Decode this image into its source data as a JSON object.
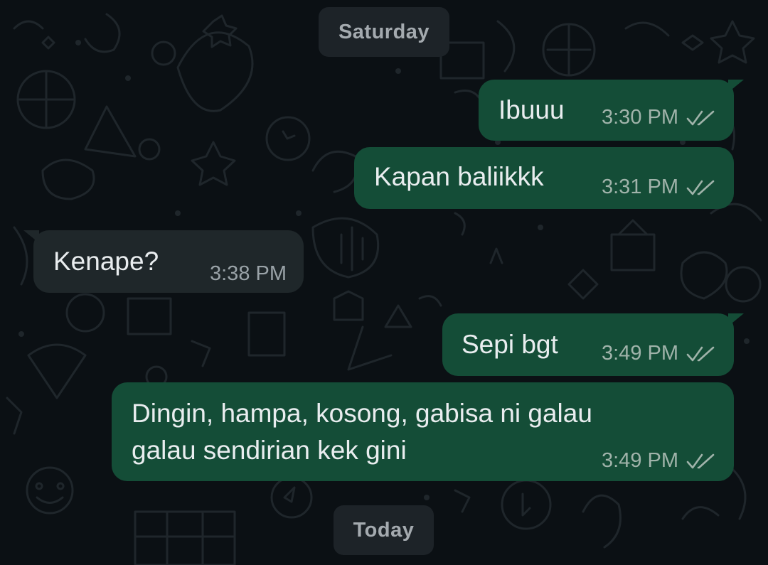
{
  "chat": {
    "date_separators": [
      {
        "label": "Saturday"
      },
      {
        "label": "Today"
      }
    ],
    "messages": [
      {
        "direction": "outgoing",
        "text": "Ibuuu",
        "time": "3:30 PM",
        "status": "read"
      },
      {
        "direction": "outgoing",
        "text": "Kapan baliikkk",
        "time": "3:31 PM",
        "status": "read"
      },
      {
        "direction": "incoming",
        "text": "Kenape?",
        "time": "3:38 PM"
      },
      {
        "direction": "outgoing",
        "text": "Sepi bgt",
        "time": "3:49 PM",
        "status": "read"
      },
      {
        "direction": "outgoing",
        "text_lines": [
          "Dingin, hampa, kosong, gabisa ni galau",
          "galau sendirian kek gini"
        ],
        "time": "3:49 PM",
        "status": "read"
      }
    ]
  },
  "colors": {
    "background": "#0b1014",
    "outgoing_bubble": "#144d37",
    "incoming_bubble": "#1f272a",
    "read_ticks": "#a0b3aa",
    "date_pill": "#1d2328"
  },
  "icons": {
    "read_status": "double-check-icon"
  }
}
